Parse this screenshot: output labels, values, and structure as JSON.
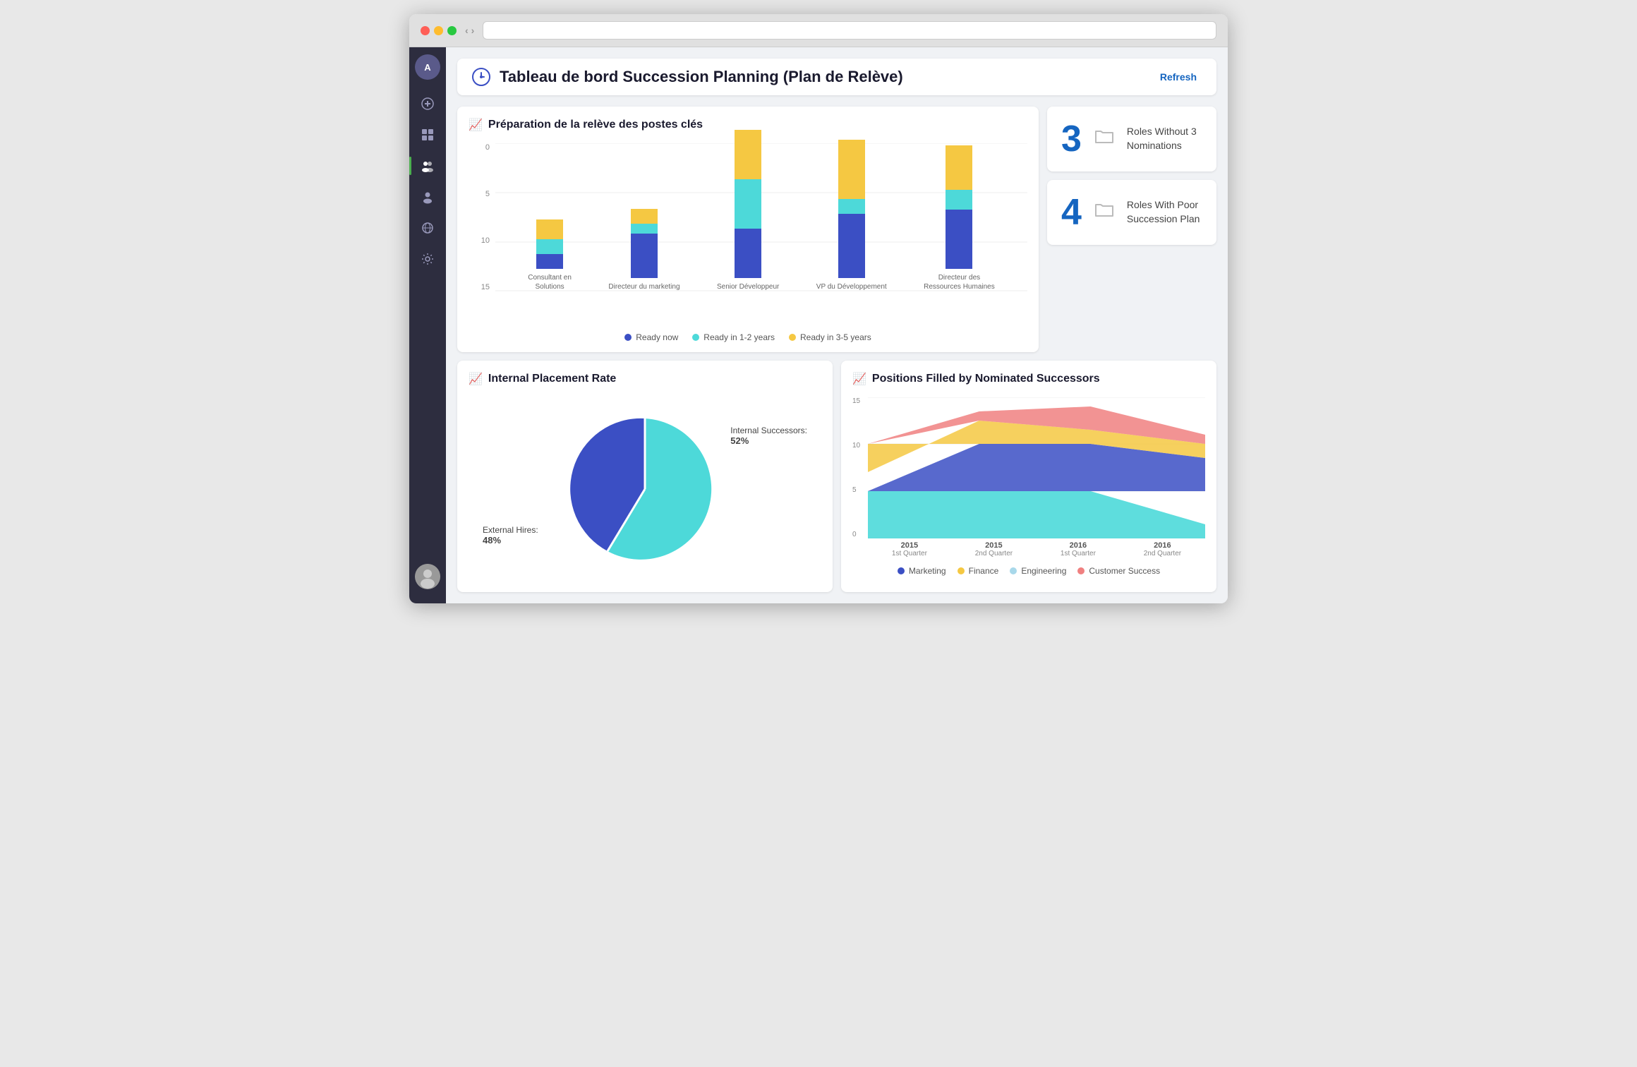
{
  "browser": {
    "nav_back": "‹",
    "nav_forward": "›"
  },
  "sidebar": {
    "avatar_label": "A",
    "items": [
      {
        "name": "add",
        "icon": "+"
      },
      {
        "name": "dashboard",
        "icon": "⊞"
      },
      {
        "name": "people",
        "icon": "👥"
      },
      {
        "name": "person",
        "icon": "👤"
      },
      {
        "name": "globe",
        "icon": "🌐"
      },
      {
        "name": "settings",
        "icon": "⚙"
      }
    ]
  },
  "header": {
    "title": "Tableau de bord Succession Planning (Plan de Relève)",
    "refresh_label": "Refresh"
  },
  "bar_chart": {
    "title": "Préparation de la relève des postes clés",
    "y_labels": [
      "0",
      "5",
      "10",
      "15"
    ],
    "bars": [
      {
        "label": "Consultant en\nSolutions",
        "ready_now": 1.5,
        "ready_1_2": 1.5,
        "ready_3_5": 2
      },
      {
        "label": "Directeur du marketing",
        "ready_now": 4.5,
        "ready_1_2": 1,
        "ready_3_5": 1.5
      },
      {
        "label": "Senior  Développeur",
        "ready_now": 5,
        "ready_1_2": 5,
        "ready_3_5": 5
      },
      {
        "label": "VP du Développement",
        "ready_now": 6.5,
        "ready_1_2": 1.5,
        "ready_3_5": 6
      },
      {
        "label": "Directeur des\nRessources Humaines",
        "ready_now": 6,
        "ready_1_2": 2,
        "ready_3_5": 4.5
      }
    ],
    "legend": [
      {
        "label": "Ready now",
        "color": "#3b4fc4"
      },
      {
        "label": "Ready in 1-2 years",
        "color": "#4dd9d9"
      },
      {
        "label": "Ready in 3-5 years",
        "color": "#f5c842"
      }
    ]
  },
  "kpi": [
    {
      "number": "3",
      "label": "Roles Without 3 Nominations",
      "icon": "folder"
    },
    {
      "number": "4",
      "label": "Roles With Poor Succession Plan",
      "icon": "folder"
    }
  ],
  "pie_chart": {
    "title": "Internal Placement Rate",
    "internal_label": "Internal Successors:",
    "internal_value": "52%",
    "external_label": "External Hires:",
    "external_value": "48%",
    "internal_pct": 52,
    "external_pct": 48
  },
  "area_chart": {
    "title": "Positions Filled by Nominated Successors",
    "y_labels": [
      "0",
      "5",
      "10",
      "15"
    ],
    "x_labels": [
      {
        "year": "2015",
        "quarter": "1st Quarter"
      },
      {
        "year": "2015",
        "quarter": "2nd Quarter"
      },
      {
        "year": "2016",
        "quarter": "1st Quarter"
      },
      {
        "year": "2016",
        "quarter": "2nd Quarter"
      }
    ],
    "legend": [
      {
        "label": "Marketing",
        "color": "#3b4fc4"
      },
      {
        "label": "Finance",
        "color": "#f5c842"
      },
      {
        "label": "Engineering",
        "color": "#a8d8ea"
      },
      {
        "label": "Customer Success",
        "color": "#f08080"
      }
    ]
  }
}
